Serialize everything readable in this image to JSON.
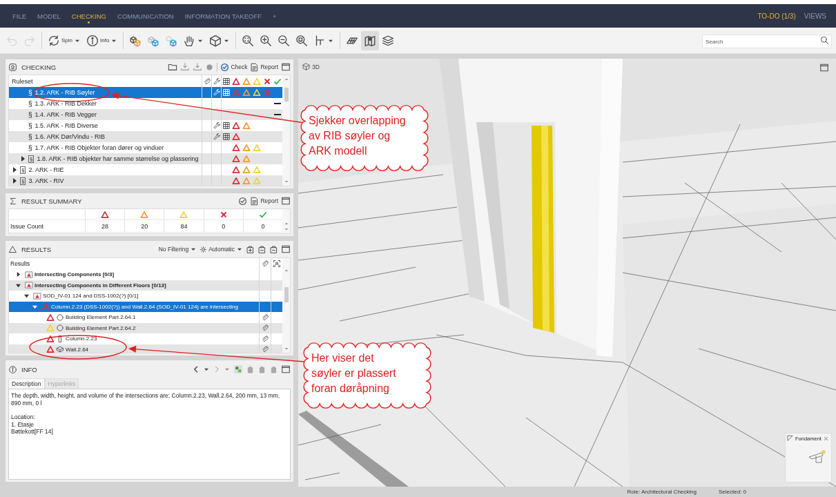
{
  "menu": {
    "tabs": [
      {
        "label": "FILE",
        "selected": false
      },
      {
        "label": "MODEL",
        "selected": false
      },
      {
        "label": "CHECKING",
        "selected": true
      },
      {
        "label": "COMMUNICATION",
        "selected": false
      },
      {
        "label": "INFORMATION TAKEOFF",
        "selected": false
      },
      {
        "label": "+",
        "selected": false
      }
    ],
    "right_tabs": [
      {
        "label": "TO-DO (1/3)",
        "selected": true
      },
      {
        "label": "VIEWS",
        "selected": false
      }
    ]
  },
  "toolbar": {
    "buttons": [
      {
        "kind": "undo",
        "dropdown": false,
        "disabled": true,
        "pressed": false
      },
      {
        "kind": "redo",
        "dropdown": false,
        "disabled": true,
        "pressed": false
      },
      {
        "kind": "separator"
      },
      {
        "kind": "spin",
        "label": "Spin",
        "dropdown": true,
        "disabled": false,
        "pressed": false
      },
      {
        "kind": "info",
        "label": "Info",
        "dropdown": true,
        "disabled": false,
        "pressed": false
      },
      {
        "kind": "separator"
      },
      {
        "kind": "show-boxes",
        "dropdown": false,
        "disabled": false,
        "pressed": false
      },
      {
        "kind": "ghost-boxes",
        "dropdown": false,
        "disabled": false,
        "pressed": false
      },
      {
        "kind": "isolate-box",
        "dropdown": false,
        "disabled": false,
        "pressed": false
      },
      {
        "kind": "hand",
        "dropdown": true,
        "disabled": false,
        "pressed": false
      },
      {
        "kind": "cube",
        "dropdown": true,
        "disabled": false,
        "pressed": false
      },
      {
        "kind": "separator"
      },
      {
        "kind": "zoom-fit",
        "dropdown": false,
        "disabled": false,
        "pressed": false
      },
      {
        "kind": "zoom-in",
        "dropdown": false,
        "disabled": false,
        "pressed": false
      },
      {
        "kind": "zoom-out",
        "dropdown": false,
        "disabled": false,
        "pressed": false
      },
      {
        "kind": "zoom-box",
        "dropdown": false,
        "disabled": false,
        "pressed": false
      },
      {
        "kind": "pick",
        "dropdown": true,
        "disabled": false,
        "pressed": false
      },
      {
        "kind": "separator"
      },
      {
        "kind": "plane",
        "dropdown": false,
        "disabled": false,
        "pressed": false
      },
      {
        "kind": "map",
        "dropdown": false,
        "disabled": false,
        "pressed": true
      },
      {
        "kind": "layers",
        "dropdown": false,
        "disabled": false,
        "pressed": false
      }
    ],
    "search": {
      "placeholder": "Search"
    }
  },
  "checking": {
    "title": "CHECKING",
    "check_label": "Check",
    "report_label": "Report",
    "column": "Ruleset",
    "mark_columns": [
      {
        "kind": "critical"
      },
      {
        "kind": "major"
      },
      {
        "kind": "minor"
      },
      {
        "kind": "failed"
      },
      {
        "kind": "passed"
      }
    ],
    "items": [
      {
        "children": [
          {
            "kind": "rule",
            "symbol": "§",
            "label": "1.2. ARK - RIB Søyler",
            "selected": true,
            "wrench": true,
            "table": true,
            "marks": [
              {
                "kind": "critical"
              },
              {
                "kind": "major"
              },
              {
                "kind": "minor"
              },
              {
                "kind": "failed"
              }
            ]
          },
          {
            "kind": "rule",
            "symbol": "§",
            "label": "1.3. ARK - RIB Dekker",
            "selected": false,
            "wrench": false,
            "table": false,
            "marks": [
              {
                "kind": "not_run"
              }
            ]
          },
          {
            "kind": "rule",
            "symbol": "§",
            "label": "1.4. ARK - RIB Vegger",
            "selected": false,
            "wrench": false,
            "table": false,
            "marks": [
              {
                "kind": "not_run"
              }
            ]
          },
          {
            "kind": "rule",
            "symbol": "§",
            "label": "1.5. ARK - RIB Diverse",
            "selected": false,
            "wrench": true,
            "table": true,
            "marks": [
              {
                "kind": "critical"
              },
              {
                "kind": "major"
              }
            ]
          },
          {
            "kind": "rule",
            "symbol": "§",
            "label": "1.6. ARK Dør/Vindu - RIB",
            "selected": false,
            "wrench": true,
            "table": true,
            "marks": [
              {
                "kind": "critical"
              }
            ]
          },
          {
            "kind": "rule",
            "symbol": "§",
            "label": "1.7. ARK - RIB Objekter foran dører og vinduer",
            "selected": false,
            "wrench": false,
            "table": false,
            "marks": [
              {
                "kind": "critical"
              },
              {
                "kind": "major"
              },
              {
                "kind": "minor"
              }
            ]
          },
          {
            "kind": "group",
            "symbol": "§",
            "label": "1.8. ARK - RIB objekter har samme størrelse og plassering",
            "expanded": false,
            "selected": false,
            "wrench": false,
            "table": false,
            "marks": [
              {
                "kind": "critical"
              },
              {
                "kind": "major"
              }
            ]
          }
        ]
      },
      {
        "kind": "group",
        "symbol": "§",
        "label": "2. ARK - RIE",
        "expanded": false,
        "selected": false,
        "wrench": false,
        "table": false,
        "marks": [
          {
            "kind": "critical"
          },
          {
            "kind": "major"
          },
          {
            "kind": "minor"
          }
        ]
      },
      {
        "kind": "group",
        "symbol": "§",
        "label": "3. ARK - RIV",
        "expanded": false,
        "selected": false,
        "wrench": false,
        "table": false,
        "marks": [
          {
            "kind": "critical"
          },
          {
            "kind": "major"
          },
          {
            "kind": "minor"
          }
        ]
      }
    ]
  },
  "summary": {
    "title": "RESULT SUMMARY",
    "report_label": "Report",
    "row_label": "Issue Count",
    "columns": [
      {
        "kind": "critical",
        "value": "28"
      },
      {
        "kind": "major",
        "value": "20"
      },
      {
        "kind": "minor",
        "value": "84"
      },
      {
        "kind": "failed",
        "value": "0"
      },
      {
        "kind": "passed",
        "value": "0"
      }
    ]
  },
  "results": {
    "title": "RESULTS",
    "filter": "No Filtering",
    "mode": "Automatic",
    "column": "Results",
    "items": [
      {
        "kind": "group",
        "label": "Intersecting Components [0/3]",
        "expanded": false,
        "selected": false
      },
      {
        "kind": "group",
        "label": "Intersecting Components in Different Floors [0/13]",
        "expanded": true,
        "selected": false,
        "children": [
          {
            "kind": "group",
            "label": "SOD_IV-01 124 and DSS-1002(?) [0/1]",
            "expanded": true,
            "selected": false,
            "children": [
              {
                "kind": "issue",
                "label": "Column.2.23 (DSS-1002(?)) and Wall.2.64 (SOD_IV-01 124) are intersecting",
                "severity": {
                  "kind": "critical"
                },
                "expanded": true,
                "selected": true,
                "children": [
                  {
                    "kind": "element",
                    "element": {
                      "kind": "part"
                    },
                    "label": "Building Element Part.2.64.1",
                    "severity": {
                      "kind": "critical"
                    },
                    "selected": false,
                    "attachment": true
                  },
                  {
                    "kind": "element",
                    "element": {
                      "kind": "part"
                    },
                    "label": "Building Element Part.2.64.2",
                    "severity": {
                      "kind": "minor"
                    },
                    "selected": false,
                    "attachment": true
                  },
                  {
                    "kind": "element",
                    "element": {
                      "kind": "column"
                    },
                    "label": "Column.2.23",
                    "severity": {
                      "kind": "critical"
                    },
                    "selected": false,
                    "attachment": true
                  },
                  {
                    "kind": "element",
                    "element": {
                      "kind": "wall"
                    },
                    "label": "Wall.2.64",
                    "severity": {
                      "kind": "critical"
                    },
                    "selected": false,
                    "attachment": true
                  }
                ]
              }
            ]
          }
        ]
      }
    ]
  },
  "info": {
    "title": "INFO",
    "tabs": [
      {
        "label": "Description",
        "selected": true
      },
      {
        "label": "Hyperlinks",
        "selected": false
      }
    ],
    "description": "The depth, width, height, and volume of the intersections are: Column.2.23, Wall.2.64, 200 mm, 13 mm, 890 mm, 0 l",
    "location_lines": [
      "Location:",
      "1. Etasje",
      "Bøttekott[FF 14]"
    ]
  },
  "viewport": {
    "label": "3D",
    "minimap": {
      "label": "Fundament"
    }
  },
  "status_bar": {
    "role": "Role: Architectural Checking",
    "selected": "Selected: 0"
  },
  "callouts": [
    {
      "text": "Sjekker overlapping\nav RIB søyler og\nARK modell"
    },
    {
      "text": "Her viser det\nsøyler er plassert\nforan døråpning"
    }
  ]
}
